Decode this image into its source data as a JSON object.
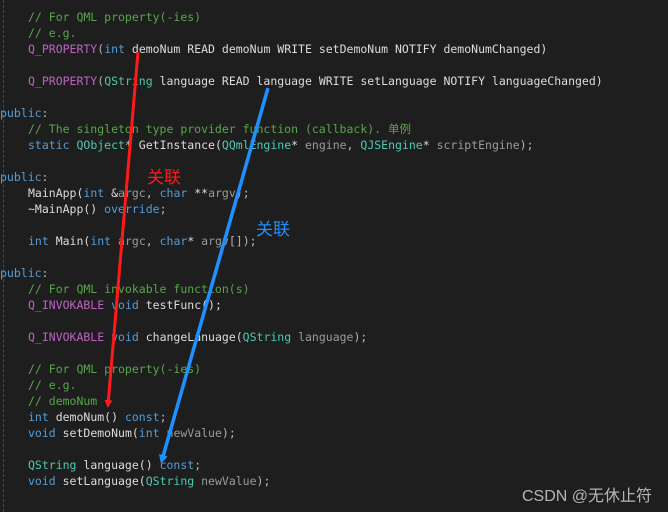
{
  "colors": {
    "background": "#1e1e1e",
    "comment": "#57a64a",
    "keyword": "#569cd6",
    "macro": "#bd63c5",
    "type": "#4ec9b0",
    "arrow_red": "#ff1a1a",
    "arrow_blue": "#1e90ff"
  },
  "code": [
    {
      "indent": true,
      "tokens": [
        [
          "// For QML property(-ies)",
          "cm"
        ]
      ]
    },
    {
      "indent": true,
      "tokens": [
        [
          "// e.g.",
          "cm"
        ]
      ]
    },
    {
      "indent": true,
      "tokens": [
        [
          "Q_PROPERTY",
          "mac"
        ],
        [
          "(",
          "pu"
        ],
        [
          "int",
          "kw"
        ],
        [
          " demoNum READ demoNum WRITE setDemoNum NOTIFY demoNumChanged)",
          "id"
        ]
      ]
    },
    {
      "indent": true,
      "tokens": []
    },
    {
      "indent": true,
      "tokens": [
        [
          "Q_PROPERTY",
          "mac"
        ],
        [
          "(",
          "pu"
        ],
        [
          "QString",
          "ty"
        ],
        [
          " language READ language WRITE setLanguage NOTIFY languageChanged)",
          "id"
        ]
      ]
    },
    {
      "indent": false,
      "tokens": []
    },
    {
      "indent": false,
      "tokens": [
        [
          "public",
          "kw"
        ],
        [
          ":",
          "pu"
        ]
      ]
    },
    {
      "indent": true,
      "tokens": [
        [
          "// The singleton type provider function (callback). 单例",
          "cm"
        ]
      ]
    },
    {
      "indent": true,
      "tokens": [
        [
          "static",
          "kw"
        ],
        [
          " ",
          "id"
        ],
        [
          "QObject",
          "ty"
        ],
        [
          "* GetInstance(",
          "id"
        ],
        [
          "QQmlEngine",
          "ty"
        ],
        [
          "* ",
          "id"
        ],
        [
          "engine",
          "p"
        ],
        [
          ", ",
          "pu"
        ],
        [
          "QJSEngine",
          "ty"
        ],
        [
          "* ",
          "id"
        ],
        [
          "scriptEngine",
          "p"
        ],
        [
          ");",
          "pu"
        ]
      ]
    },
    {
      "indent": false,
      "tokens": []
    },
    {
      "indent": false,
      "tokens": [
        [
          "public",
          "kw"
        ],
        [
          ":",
          "pu"
        ]
      ]
    },
    {
      "indent": true,
      "tokens": [
        [
          "MainApp(",
          "id"
        ],
        [
          "int",
          "kw"
        ],
        [
          " &",
          "id"
        ],
        [
          "argc",
          "p"
        ],
        [
          ", ",
          "pu"
        ],
        [
          "char",
          "kw"
        ],
        [
          " **",
          "id"
        ],
        [
          "argv",
          "p"
        ],
        [
          ");",
          "pu"
        ]
      ]
    },
    {
      "indent": true,
      "tokens": [
        [
          "~MainApp() ",
          "id"
        ],
        [
          "override",
          "kw"
        ],
        [
          ";",
          "pu"
        ]
      ]
    },
    {
      "indent": false,
      "tokens": []
    },
    {
      "indent": true,
      "tokens": [
        [
          "int",
          "kw"
        ],
        [
          " Main(",
          "id"
        ],
        [
          "int",
          "kw"
        ],
        [
          " ",
          "id"
        ],
        [
          "argc",
          "p"
        ],
        [
          ", ",
          "pu"
        ],
        [
          "char",
          "kw"
        ],
        [
          "* ",
          "id"
        ],
        [
          "argv",
          "p"
        ],
        [
          "[]);",
          "pu"
        ]
      ]
    },
    {
      "indent": false,
      "tokens": []
    },
    {
      "indent": false,
      "tokens": [
        [
          "public",
          "kw"
        ],
        [
          ":",
          "pu"
        ]
      ]
    },
    {
      "indent": true,
      "tokens": [
        [
          "// For QML invokable function(s)",
          "cm"
        ]
      ]
    },
    {
      "indent": true,
      "tokens": [
        [
          "Q_INVOKABLE",
          "mac"
        ],
        [
          " ",
          "id"
        ],
        [
          "void",
          "kw"
        ],
        [
          " testFunc();",
          "id"
        ]
      ]
    },
    {
      "indent": true,
      "tokens": []
    },
    {
      "indent": true,
      "tokens": [
        [
          "Q_INVOKABLE",
          "mac"
        ],
        [
          " ",
          "id"
        ],
        [
          "void",
          "kw"
        ],
        [
          " changeLanuage(",
          "id"
        ],
        [
          "QString",
          "ty"
        ],
        [
          " ",
          "id"
        ],
        [
          "language",
          "p"
        ],
        [
          ");",
          "pu"
        ]
      ]
    },
    {
      "indent": true,
      "tokens": []
    },
    {
      "indent": true,
      "tokens": [
        [
          "// For QML property(-ies)",
          "cm"
        ]
      ]
    },
    {
      "indent": true,
      "tokens": [
        [
          "// e.g.",
          "cm"
        ]
      ]
    },
    {
      "indent": true,
      "tokens": [
        [
          "// demoNum",
          "cm"
        ]
      ]
    },
    {
      "indent": true,
      "tokens": [
        [
          "int",
          "kw"
        ],
        [
          " demoNum() ",
          "id"
        ],
        [
          "const",
          "kw"
        ],
        [
          ";",
          "pu"
        ]
      ]
    },
    {
      "indent": true,
      "tokens": [
        [
          "void",
          "kw"
        ],
        [
          " setDemoNum(",
          "id"
        ],
        [
          "int",
          "kw"
        ],
        [
          " ",
          "id"
        ],
        [
          "newValue",
          "p"
        ],
        [
          ");",
          "pu"
        ]
      ]
    },
    {
      "indent": true,
      "tokens": []
    },
    {
      "indent": true,
      "tokens": [
        [
          "QString",
          "ty"
        ],
        [
          " language() ",
          "id"
        ],
        [
          "const",
          "kw"
        ],
        [
          ";",
          "pu"
        ]
      ]
    },
    {
      "indent": true,
      "tokens": [
        [
          "void",
          "kw"
        ],
        [
          " setLanguage(",
          "id"
        ],
        [
          "QString",
          "ty"
        ],
        [
          " ",
          "id"
        ],
        [
          "newValue",
          "p"
        ],
        [
          ");",
          "pu"
        ]
      ]
    }
  ],
  "annotations": {
    "red_label": "关联",
    "blue_label": "关联"
  },
  "watermark": "CSDN @无休止符"
}
